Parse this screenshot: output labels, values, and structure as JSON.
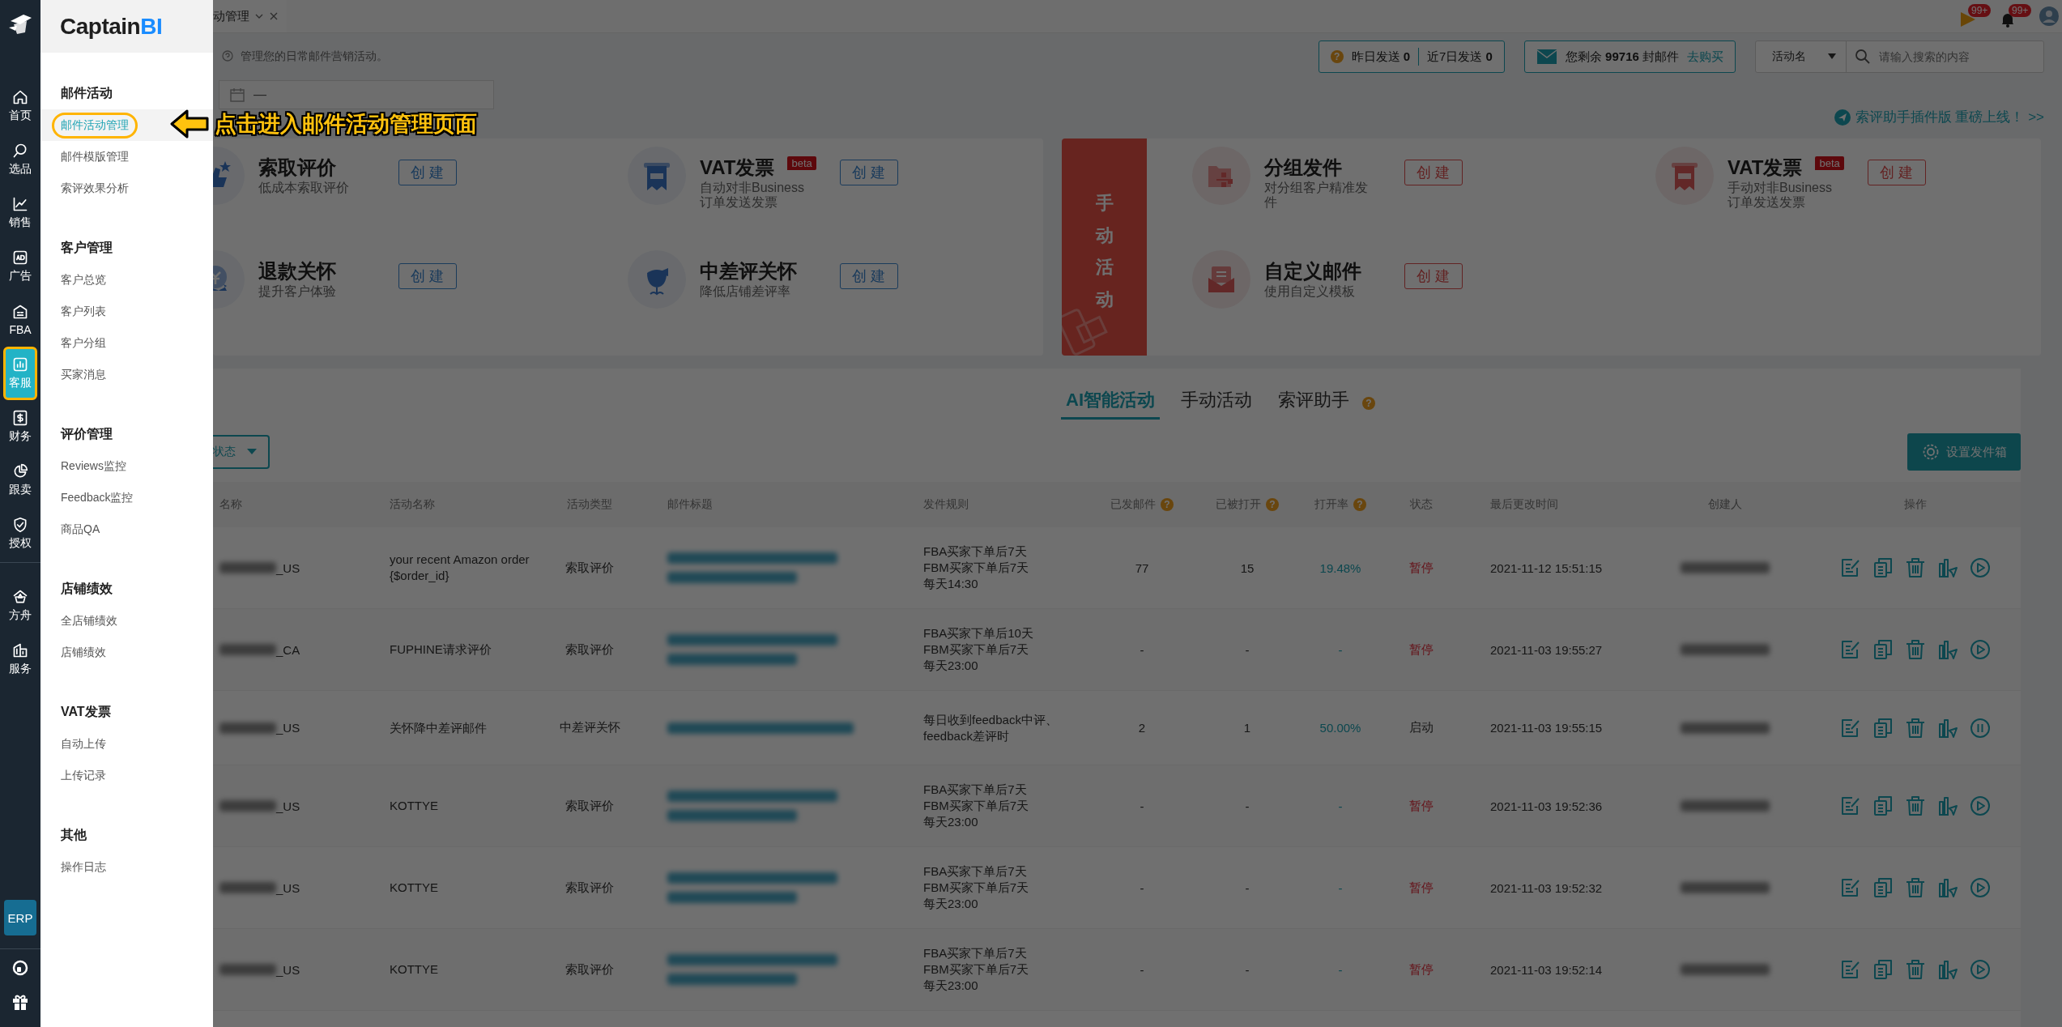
{
  "rail": {
    "items": [
      {
        "label": "首页",
        "kind": "home",
        "selected": false,
        "highlighted": false
      },
      {
        "label": "选品",
        "kind": "search",
        "selected": false,
        "highlighted": false
      },
      {
        "label": "销售",
        "kind": "trend",
        "selected": false,
        "highlighted": false
      },
      {
        "label": "广告",
        "kind": "ad",
        "selected": false,
        "highlighted": false
      },
      {
        "label": "FBA",
        "kind": "box",
        "selected": false,
        "highlighted": false
      },
      {
        "label": "客服",
        "kind": "service",
        "selected": true,
        "highlighted": true
      },
      {
        "label": "财务",
        "kind": "finance",
        "selected": false,
        "highlighted": false
      },
      {
        "label": "跟卖",
        "kind": "pie",
        "selected": false,
        "highlighted": false
      },
      {
        "label": "授权",
        "kind": "shield",
        "selected": false,
        "highlighted": false
      }
    ],
    "extra_items": [
      {
        "label": "方舟",
        "kind": "ark",
        "selected": false,
        "highlighted": false
      },
      {
        "label": "服务",
        "kind": "building",
        "selected": false,
        "highlighted": false
      }
    ],
    "erp_button": "ERP"
  },
  "flyout": {
    "logo": {
      "main": "Captain",
      "accent": "BI"
    },
    "groups": [
      {
        "heading": "邮件活动",
        "items": [
          {
            "label": "邮件活动管理",
            "selected": true,
            "highlighted": true
          },
          {
            "label": "邮件模版管理",
            "selected": false,
            "highlighted": false
          },
          {
            "label": "索评效果分析",
            "selected": false,
            "highlighted": false
          }
        ]
      },
      {
        "heading": "客户管理",
        "items": [
          {
            "label": "客户总览",
            "selected": false,
            "highlighted": false
          },
          {
            "label": "客户列表",
            "selected": false,
            "highlighted": false
          },
          {
            "label": "客户分组",
            "selected": false,
            "highlighted": false
          },
          {
            "label": "买家消息",
            "selected": false,
            "highlighted": false
          }
        ]
      },
      {
        "heading": "评价管理",
        "items": [
          {
            "label": "Reviews监控",
            "selected": false,
            "highlighted": false
          },
          {
            "label": "Feedback监控",
            "selected": false,
            "highlighted": false
          },
          {
            "label": "商品QA",
            "selected": false,
            "highlighted": false
          }
        ]
      },
      {
        "heading": "店铺绩效",
        "items": [
          {
            "label": "全店铺绩效",
            "selected": false,
            "highlighted": false
          },
          {
            "label": "店铺绩效",
            "selected": false,
            "highlighted": false
          }
        ]
      },
      {
        "heading": "VAT发票",
        "items": [
          {
            "label": "自动上传",
            "selected": false,
            "highlighted": false
          },
          {
            "label": "上传记录",
            "selected": false,
            "highlighted": false
          }
        ]
      },
      {
        "heading": "其他",
        "items": [
          {
            "label": "操作日志",
            "selected": false,
            "highlighted": false
          }
        ]
      }
    ]
  },
  "annotation": {
    "text": "点击进入邮件活动管理页面"
  },
  "top_bar": {
    "tab": {
      "label": "动管理"
    },
    "notifications": [
      {
        "kind": "flag",
        "badge": "99+"
      },
      {
        "kind": "bell",
        "badge": "99+"
      }
    ]
  },
  "header": {
    "hint": "管理您的日常邮件营销活动。",
    "stats": {
      "help": "?",
      "yesterday": "昨日发送 **0**",
      "week": "近7日发送 **0**"
    },
    "quota": {
      "text": "您剩余 **99716** 封邮件",
      "link": "去购买"
    },
    "search": {
      "field": "活动名",
      "placeholder": "请输入搜索的内容"
    },
    "date_range": {
      "separator": "—"
    },
    "promo_link": "索评助手插件版 重磅上线！ >>"
  },
  "cards": [
    {
      "kind": "ai",
      "items": [
        {
          "kind": "thumbs-up",
          "title": "索取评价",
          "subtitle": "低成本索取评价",
          "button": "创 建"
        },
        {
          "kind": "vat",
          "title": "VAT发票",
          "badge": "beta",
          "subtitle": "自动对非Business订单发送发票",
          "button": "创 建"
        },
        {
          "kind": "refund",
          "title": "退款关怀",
          "subtitle": "提升客户体验",
          "button": "创 建"
        },
        {
          "kind": "flower",
          "title": "中差评关怀",
          "subtitle": "降低店铺差评率",
          "button": "创 建"
        }
      ]
    },
    {
      "kind": "manual",
      "label": "手动活动",
      "items": [
        {
          "kind": "group",
          "title": "分组发件",
          "subtitle": "对分组客户精准发件",
          "button": "创 建"
        },
        {
          "kind": "vat",
          "title": "VAT发票",
          "badge": "beta",
          "subtitle": "手动对非Business订单发送发票",
          "button": "创 建"
        },
        {
          "kind": "mail",
          "title": "自定义邮件",
          "subtitle": "使用自定义模板",
          "button": "创 建"
        }
      ]
    }
  ],
  "panel": {
    "tabs": [
      {
        "label": "AI智能活动",
        "selected": true
      },
      {
        "label": "手动活动",
        "selected": false
      },
      {
        "label": "索评助手",
        "selected": false,
        "help": "?"
      }
    ],
    "filter": {
      "label": "状态"
    },
    "settings_button": "设置发件箱",
    "table": {
      "columns": [
        {
          "label": "名称"
        },
        {
          "label": "活动名称"
        },
        {
          "label": "活动类型"
        },
        {
          "label": "邮件标题"
        },
        {
          "label": "发件规则"
        },
        {
          "label": "已发邮件",
          "help": "?"
        },
        {
          "label": "已被打开",
          "help": "?"
        },
        {
          "label": "打开率",
          "help": "?"
        },
        {
          "label": "状态"
        },
        {
          "label": "最后更改时间"
        },
        {
          "label": "创建人"
        },
        {
          "label": "操作"
        }
      ],
      "rows": [
        {
          "store": "_US",
          "name": "your recent Amazon order {$order_id}",
          "type": "索取评价",
          "subject_wrapped": true,
          "rule": [
            "FBA买家下单后7天",
            "FBM买家下单后7天",
            "每天14:30"
          ],
          "sent": "77",
          "opened": "15",
          "rate": "19.48%",
          "status": {
            "label": "暂停",
            "running": false
          },
          "modified": "2021-11-12 15:51:15"
        },
        {
          "store": "_CA",
          "name": "FUPHINE请求评价",
          "type": "索取评价",
          "subject_wrapped": true,
          "rule": [
            "FBA买家下单后10天",
            "FBM买家下单后7天",
            "每天23:00"
          ],
          "sent": "-",
          "opened": "-",
          "rate": "-",
          "status": {
            "label": "暂停",
            "running": false
          },
          "modified": "2021-11-03 19:55:27"
        },
        {
          "store": "_US",
          "name": "关怀降中差评邮件",
          "type": "中差评关怀",
          "subject_wrapped": false,
          "rule": [
            "每日收到feedback中评、",
            "feedback差评时"
          ],
          "sent": "2",
          "opened": "1",
          "rate": "50.00%",
          "status": {
            "label": "启动",
            "running": true
          },
          "modified": "2021-11-03 19:55:15"
        },
        {
          "store": "_US",
          "name": "KOTTYE",
          "type": "索取评价",
          "subject_wrapped": true,
          "rule": [
            "FBA买家下单后7天",
            "FBM买家下单后7天",
            "每天23:00"
          ],
          "sent": "-",
          "opened": "-",
          "rate": "-",
          "status": {
            "label": "暂停",
            "running": false
          },
          "modified": "2021-11-03 19:52:36"
        },
        {
          "store": "_US",
          "name": "KOTTYE",
          "type": "索取评价",
          "subject_wrapped": true,
          "rule": [
            "FBA买家下单后7天",
            "FBM买家下单后7天",
            "每天23:00"
          ],
          "sent": "-",
          "opened": "-",
          "rate": "-",
          "status": {
            "label": "暂停",
            "running": false
          },
          "modified": "2021-11-03 19:52:32"
        },
        {
          "store": "_US",
          "name": "KOTTYE",
          "type": "索取评价",
          "subject_wrapped": true,
          "rule": [
            "FBA买家下单后7天",
            "FBM买家下单后7天",
            "每天23:00"
          ],
          "sent": "-",
          "opened": "-",
          "rate": "-",
          "status": {
            "label": "暂停",
            "running": false
          },
          "modified": "2021-11-03 19:52:14"
        }
      ]
    }
  }
}
